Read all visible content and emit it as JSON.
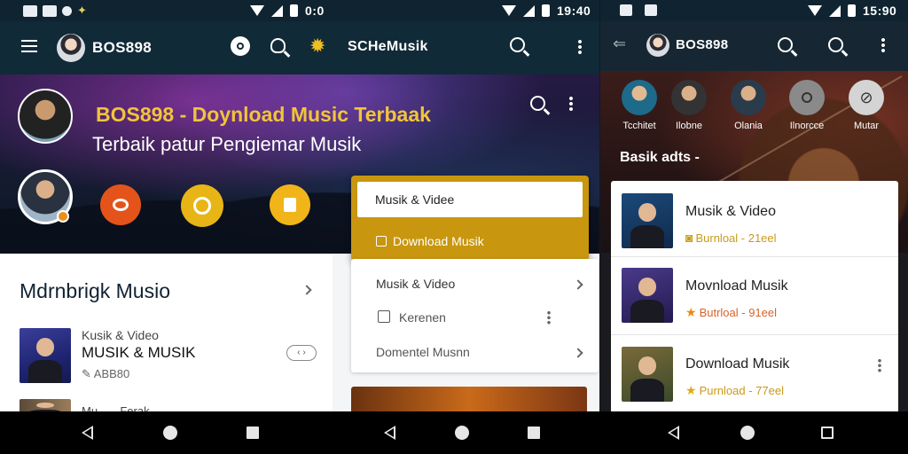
{
  "panel1": {
    "status": {
      "time_left": "0:0",
      "time_right": "19:40"
    },
    "appbar": {
      "user_name": "BOS898",
      "brand": "SCHeMusik"
    },
    "hero": {
      "title": "BOS898 - Doynload Music Terbaak",
      "subtitle": "Terbaik patur Pengiemar Musik"
    },
    "category_icons": [
      "chat-bubble-icon",
      "dial-icon",
      "flag-icon"
    ],
    "dropdown": {
      "selected": "Musik & Videe",
      "option": "Download Musik"
    },
    "section": {
      "title": "Mdrnbrigk Musio",
      "item": {
        "overline": "Kusik & Video",
        "title": "MUSIK & MUSIK",
        "meta": "ABB80"
      },
      "next_item_preview": "Mu... ...Ferak"
    },
    "menu_card": {
      "rows": [
        "Musik & Video",
        "Kerenen",
        "Domentel Musnn"
      ]
    }
  },
  "panel2": {
    "status": {
      "time": "15:90"
    },
    "appbar": {
      "user_name": "BOS898"
    },
    "categories": [
      {
        "label": "Tcchitet",
        "icon": "avatar"
      },
      {
        "label": "Ilobne",
        "icon": "avatar"
      },
      {
        "label": "Olania",
        "icon": "avatar"
      },
      {
        "label": "Ilnorcce",
        "icon": "search-icon"
      },
      {
        "label": "Mutar",
        "icon": "cancel-icon"
      }
    ],
    "section_title": "Basik adts -",
    "list": [
      {
        "title": "Musik & Video",
        "meta": "Burnloal - 21eel",
        "icon": "badge-icon"
      },
      {
        "title": "Movnload Musik",
        "meta": "Butrloal - 91eel",
        "icon": "star-icon"
      },
      {
        "title": "Download Musik",
        "meta": "Purnload - 77eel",
        "icon": "star-icon"
      }
    ]
  },
  "colors": {
    "accent_gold": "#c8960f",
    "title_gold": "#f2c43a",
    "appbar": "#112a37"
  }
}
